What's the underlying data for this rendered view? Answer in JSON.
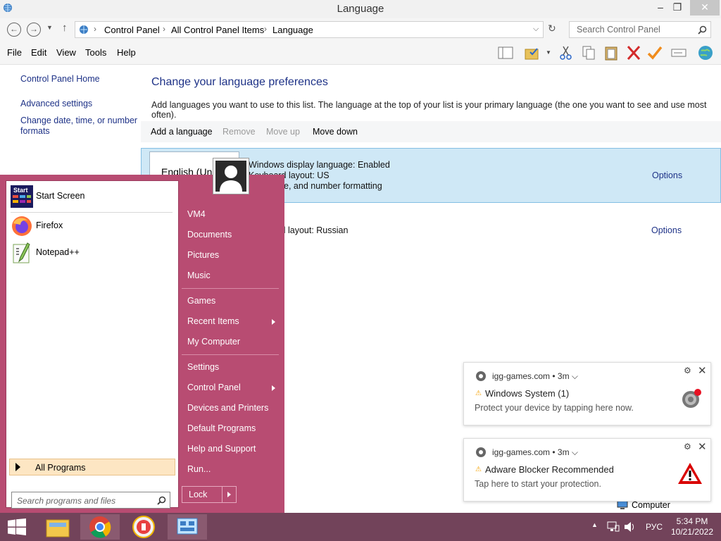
{
  "window": {
    "title": "Language",
    "minimize_glyph": "–",
    "maximize_glyph": "❐",
    "close_glyph": "✕"
  },
  "address": {
    "crumbs": [
      "Control Panel",
      "All Control Panel Items",
      "Language"
    ],
    "search_placeholder": "Search Control Panel"
  },
  "menu": [
    "File",
    "Edit",
    "View",
    "Tools",
    "Help"
  ],
  "toolbar_icons": [
    "panes-icon",
    "folder-check-icon",
    "cut-icon",
    "copy-icon",
    "paste-icon",
    "delete-icon",
    "check-icon",
    "rename-icon",
    "globe-icon"
  ],
  "left_nav": {
    "home": "Control Panel Home",
    "advanced": "Advanced settings",
    "change_date_1": "Change date, time, or number",
    "change_date_2": "formats"
  },
  "main": {
    "heading": "Change your language preferences",
    "description": "Add languages you want to use to this list. The language at the top of your list is your primary language (the one you want to see and use most often).",
    "commands": {
      "add": "Add a language",
      "remove": "Remove",
      "move_up": "Move up",
      "move_down": "Move down"
    },
    "languages": [
      {
        "name": "English (Uni",
        "line1": "Windows display language: Enabled",
        "line2": "Keyboard layout: US",
        "line3": "Date, time, and number formatting",
        "options": "Options"
      },
      {
        "name": "",
        "line1": "Keyboard layout: Russian",
        "options": "Options"
      }
    ]
  },
  "start_menu": {
    "pinned": [
      {
        "label": "Start Screen",
        "icon": "start-screen-icon",
        "badge": "Start"
      },
      {
        "label": "Firefox",
        "icon": "firefox-icon"
      },
      {
        "label": "Notepad++",
        "icon": "notepadpp-icon"
      }
    ],
    "all_programs": "All Programs",
    "search_placeholder": "Search programs and files",
    "right_items": [
      "VM4",
      "Documents",
      "Pictures",
      "Music",
      "Games",
      "Recent Items",
      "My Computer",
      "Settings",
      "Control Panel",
      "Devices and Printers",
      "Default Programs",
      "Help and Support",
      "Run..."
    ],
    "lock": "Lock"
  },
  "notifications": [
    {
      "source": "igg-games.com",
      "age": "3m",
      "title": "Windows System (1)",
      "body": "Protect your device by tapping here now.",
      "icon": "system-gear-icon",
      "badge_color": "#e81123"
    },
    {
      "source": "igg-games.com",
      "age": "3m",
      "title": "Adware Blocker Recommended",
      "body": "Tap here to start your protection.",
      "icon": "warning-triangle-icon"
    }
  ],
  "computer_label": "Computer",
  "taskbar": {
    "apps": [
      "file-explorer-icon",
      "chrome-icon",
      "keepass-icon",
      "control-panel-icon"
    ],
    "language": "РУС",
    "time": "5:34 PM",
    "date": "10/21/2022"
  },
  "colors": {
    "start_menu": "#b84c72",
    "taskbar": "#72435a",
    "link": "#1e3287",
    "selected_row": "#cfe8f6"
  }
}
